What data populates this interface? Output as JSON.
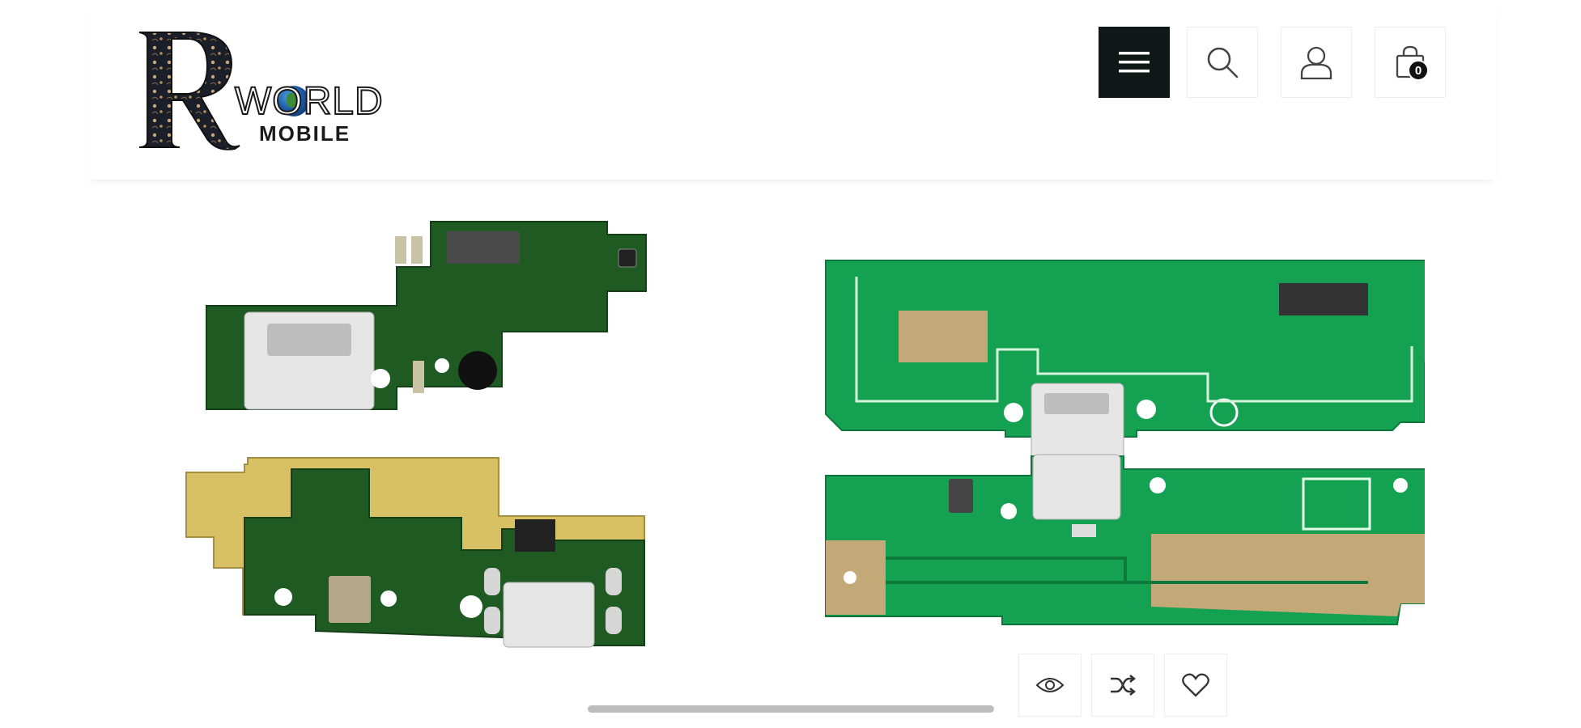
{
  "header": {
    "logo": {
      "initial": "R",
      "word1": "WORLD",
      "word2": "MOBILE"
    },
    "icons": {
      "menu": "menu-icon",
      "search": "search-icon",
      "account": "user-icon",
      "cart": "bag-icon"
    },
    "cart_count": "0"
  },
  "product": {
    "image": "charging-port-flex-boards",
    "actions": {
      "quick_view": "eye-icon",
      "compare": "shuffle-icon",
      "wishlist": "heart-icon"
    }
  },
  "colors": {
    "menu_bg": "#0f1717",
    "pcb_dark": "#1f5a22",
    "pcb_light": "#14a152",
    "gold": "#d8c165"
  }
}
